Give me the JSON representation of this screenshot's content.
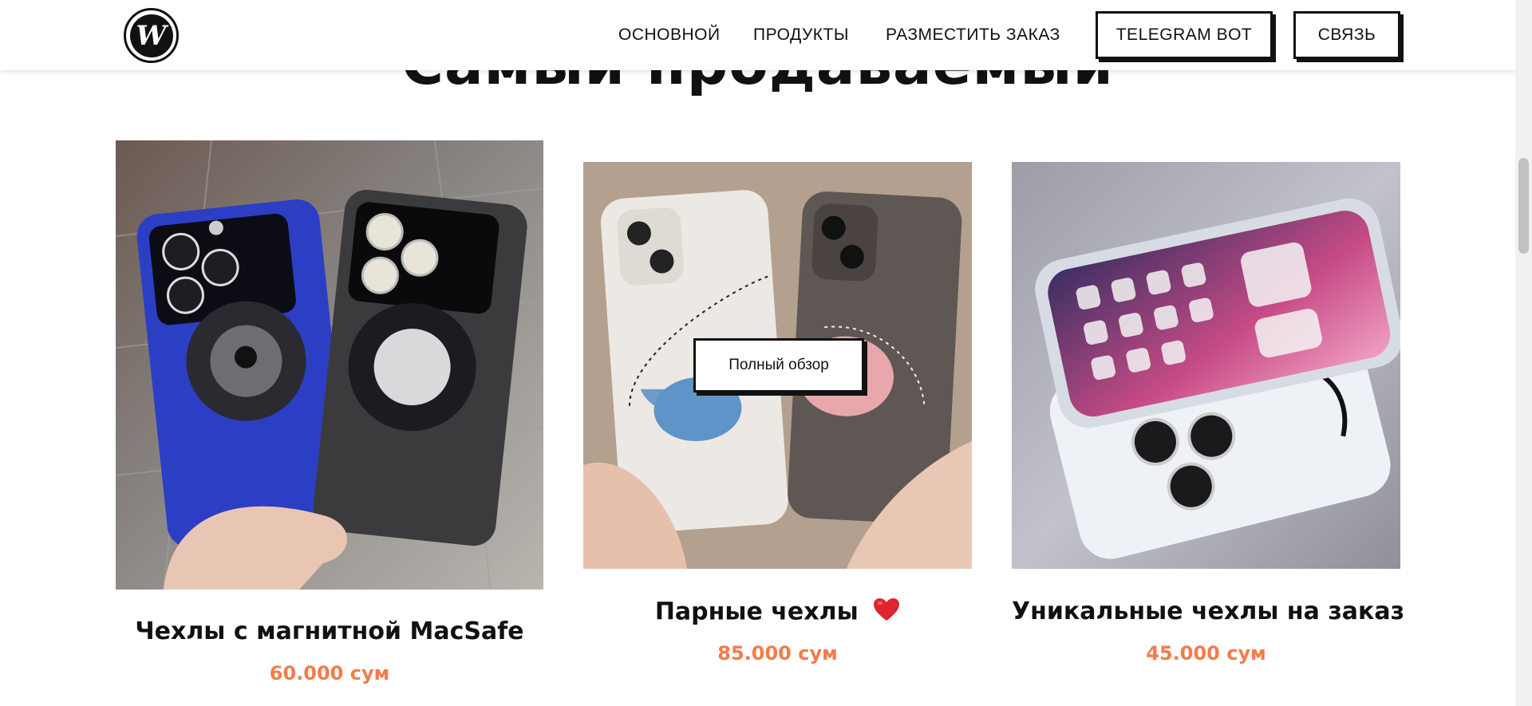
{
  "header": {
    "logo_letter": "W",
    "nav": {
      "main": "ОСНОВНОЙ",
      "products": "ПРОДУКТЫ",
      "order": "РАЗМЕСТИТЬ ЗАКАЗ",
      "telegram": "TELEGRAM BOT",
      "contact": "СВЯЗЬ"
    }
  },
  "section": {
    "title": "Самый продаваемый"
  },
  "overlay": {
    "quick_view": "Полный обзор"
  },
  "products": [
    {
      "title": "Чехлы с магнитной MacSafe",
      "price": "60.000 сум"
    },
    {
      "title": "Парные чехлы",
      "title_emoji": "heart-icon",
      "price": "85.000 сум"
    },
    {
      "title": "Уникальные чехлы на заказ",
      "price": "45.000 сум"
    }
  ],
  "colors": {
    "accent_price": "#f27c4b",
    "heart": "#e0242e"
  }
}
